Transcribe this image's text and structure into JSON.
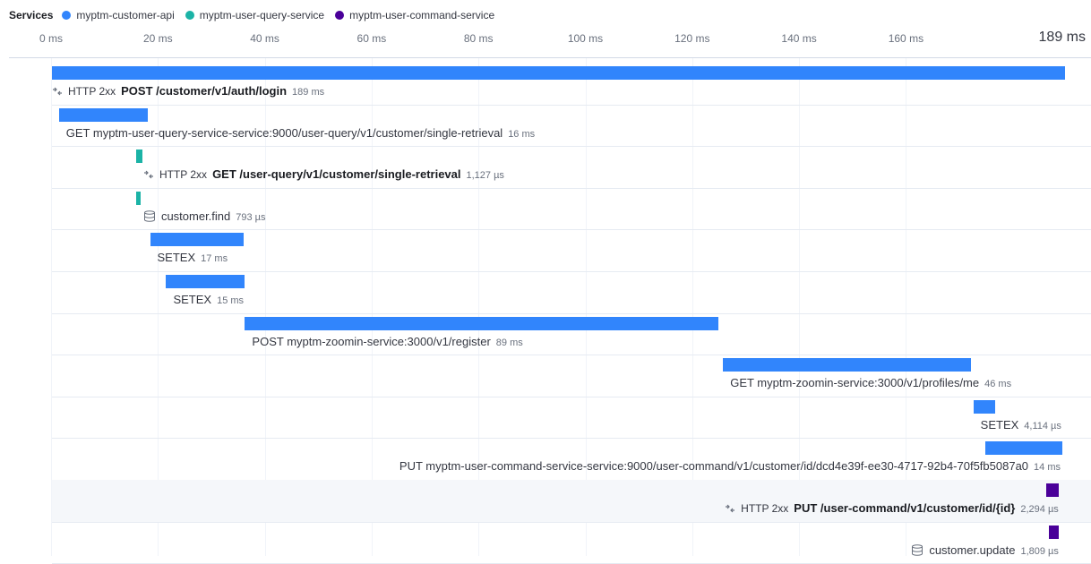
{
  "legend": {
    "title": "Services",
    "services": [
      {
        "name": "myptm-customer-api",
        "color": "#3185fc"
      },
      {
        "name": "myptm-user-query-service",
        "color": "#1bb3a6"
      },
      {
        "name": "myptm-user-command-service",
        "color": "#4a0099"
      }
    ]
  },
  "axis": {
    "ticks": [
      "0 ms",
      "20 ms",
      "40 ms",
      "60 ms",
      "80 ms",
      "100 ms",
      "120 ms",
      "140 ms",
      "160 ms"
    ],
    "max_label": "189 ms",
    "max_ms": 189
  },
  "spans": [
    {
      "service": 0,
      "start_ms": 0,
      "duration_ms": 189,
      "http": "HTTP 2xx",
      "name": "POST /customer/v1/auth/login",
      "bold": true,
      "duration_label": "189 ms",
      "icon": "transaction-icon"
    },
    {
      "service": 0,
      "start_ms": 1.3,
      "duration_ms": 16.5,
      "http": "",
      "name": "GET myptm-user-query-service-service:9000/user-query/v1/customer/single-retrieval",
      "bold": false,
      "duration_label": "16 ms",
      "icon": ""
    },
    {
      "service": 1,
      "start_ms": 15.7,
      "duration_ms": 1.127,
      "http": "HTTP 2xx",
      "name": "GET /user-query/v1/customer/single-retrieval",
      "bold": true,
      "duration_label": "1,127 µs",
      "icon": "transaction-icon"
    },
    {
      "service": 1,
      "start_ms": 15.7,
      "duration_ms": 0.793,
      "http": "",
      "name": "customer.find",
      "bold": false,
      "duration_label": "793 µs",
      "icon": "database-icon"
    },
    {
      "service": 0,
      "start_ms": 18.3,
      "duration_ms": 17.4,
      "http": "",
      "name": "SETEX",
      "bold": false,
      "duration_label": "17 ms",
      "icon": ""
    },
    {
      "service": 0,
      "start_ms": 21.3,
      "duration_ms": 14.6,
      "http": "",
      "name": "SETEX",
      "bold": false,
      "duration_label": "15 ms",
      "icon": ""
    },
    {
      "service": 0,
      "start_ms": 36.0,
      "duration_ms": 88.3,
      "http": "",
      "name": "POST myptm-zoomin-service:3000/v1/register",
      "bold": false,
      "duration_label": "89 ms",
      "icon": ""
    },
    {
      "service": 0,
      "start_ms": 125.2,
      "duration_ms": 46.2,
      "http": "",
      "name": "GET myptm-zoomin-service:3000/v1/profiles/me",
      "bold": false,
      "duration_label": "46 ms",
      "icon": ""
    },
    {
      "service": 0,
      "start_ms": 171.9,
      "duration_ms": 4.114,
      "http": "",
      "name": "SETEX",
      "bold": false,
      "duration_label": "4,114 µs",
      "icon": ""
    },
    {
      "service": 0,
      "start_ms": 174.2,
      "duration_ms": 14.3,
      "http": "",
      "name": "PUT myptm-user-command-service-service:9000/user-command/v1/customer/id/dcd4e39f-ee30-4717-92b4-70f5fb5087a0",
      "bold": false,
      "duration_label": "14 ms",
      "icon": ""
    },
    {
      "service": 2,
      "start_ms": 185.5,
      "duration_ms": 2.294,
      "http": "HTTP 2xx",
      "name": "PUT /user-command/v1/customer/id/{id}",
      "bold": true,
      "duration_label": "2,294 µs",
      "icon": "transaction-icon"
    },
    {
      "service": 2,
      "start_ms": 186.0,
      "duration_ms": 1.809,
      "http": "",
      "name": "customer.update",
      "bold": false,
      "duration_label": "1,809 µs",
      "icon": "database-icon"
    }
  ],
  "highlighted_row": 10
}
